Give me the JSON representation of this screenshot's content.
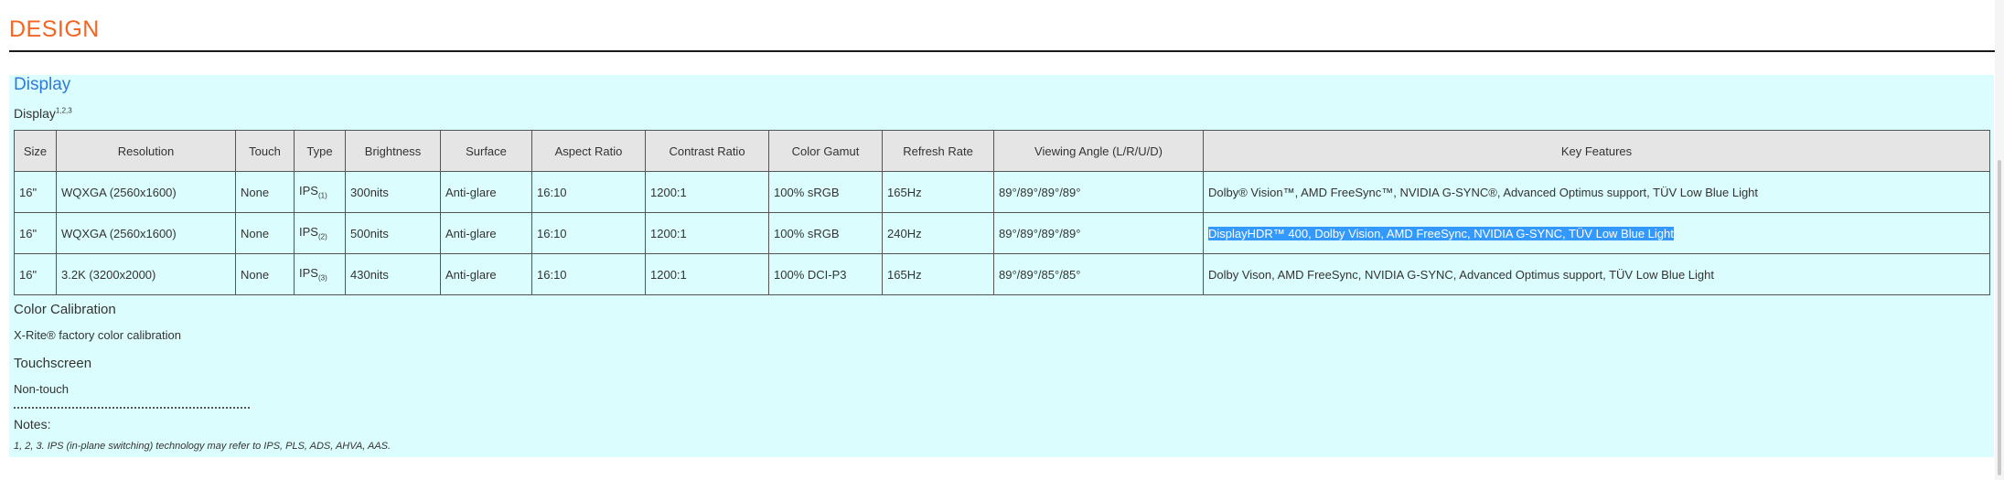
{
  "section": {
    "title": "DESIGN"
  },
  "display": {
    "title": "Display",
    "label": "Display",
    "label_marker": "1,2,3",
    "table": {
      "headers": [
        "Size",
        "Resolution",
        "Touch",
        "Type",
        "Brightness",
        "Surface",
        "Aspect Ratio",
        "Contrast Ratio",
        "Color Gamut",
        "Refresh Rate",
        "Viewing Angle (L/R/U/D)",
        "Key Features"
      ],
      "rows": [
        {
          "size": "16\"",
          "resolution": "WQXGA (2560x1600)",
          "touch": "None",
          "type": "IPS",
          "type_note": "(1)",
          "brightness": "300nits",
          "surface": "Anti-glare",
          "aspect": "16:10",
          "contrast": "1200:1",
          "gamut": "100% sRGB",
          "refresh": "165Hz",
          "angle": "89°/89°/89°/89°",
          "features": "Dolby® Vision™, AMD FreeSync™, NVIDIA G-SYNC®, Advanced Optimus support, TÜV Low Blue Light"
        },
        {
          "size": "16\"",
          "resolution": "WQXGA (2560x1600)",
          "touch": "None",
          "type": "IPS",
          "type_note": "(2)",
          "brightness": "500nits",
          "surface": "Anti-glare",
          "aspect": "16:10",
          "contrast": "1200:1",
          "gamut": "100% sRGB",
          "refresh": "240Hz",
          "angle": "89°/89°/89°/89°",
          "features": "DisplayHDR™ 400, Dolby Vision, AMD FreeSync, NVIDIA G-SYNC, TÜV Low Blue Light"
        },
        {
          "size": "16\"",
          "resolution": "3.2K (3200x2000)",
          "touch": "None",
          "type": "IPS",
          "type_note": "(3)",
          "brightness": "430nits",
          "surface": "Anti-glare",
          "aspect": "16:10",
          "contrast": "1200:1",
          "gamut": "100% DCI-P3",
          "refresh": "165Hz",
          "angle": "89°/89°/85°/85°",
          "features": "Dolby Vison, AMD FreeSync, NVIDIA G-SYNC, Advanced Optimus support, TÜV Low Blue Light"
        }
      ]
    }
  },
  "color_calibration": {
    "heading": "Color Calibration",
    "value": "X-Rite® factory color calibration"
  },
  "touchscreen": {
    "heading": "Touchscreen",
    "value": "Non-touch"
  },
  "notes": {
    "label": "Notes:",
    "text": "1, 2, 3. IPS (in-plane switching) technology may refer to IPS, PLS, ADS, AHVA, AAS."
  },
  "colors": {
    "accent_orange": "#f26522",
    "accent_blue": "#2d7bd8",
    "panel_bg": "#dcfdfd",
    "selection": "#3399ff"
  }
}
